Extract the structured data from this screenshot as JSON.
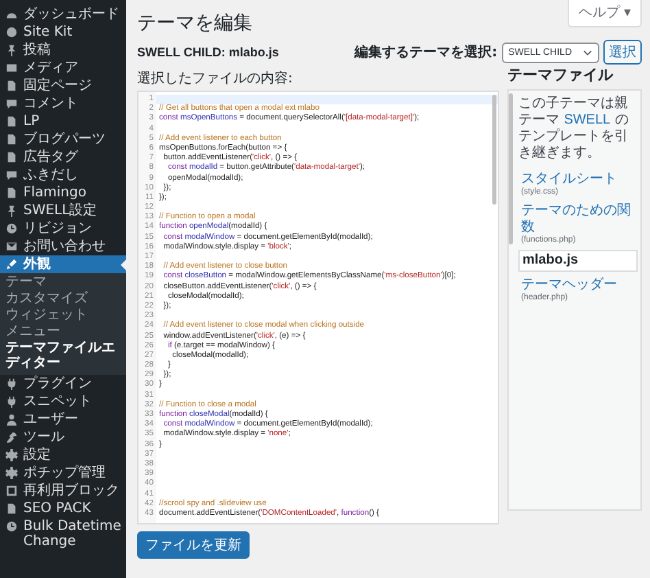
{
  "sidebar": {
    "items": [
      {
        "label": "ダッシュボード",
        "selected": false
      },
      {
        "label": "Site Kit",
        "selected": false
      },
      {
        "label": "投稿",
        "selected": false
      },
      {
        "label": "メディア",
        "selected": false
      },
      {
        "label": "固定ページ",
        "selected": false
      },
      {
        "label": "コメント",
        "selected": false
      },
      {
        "label": "LP",
        "selected": false
      },
      {
        "label": "ブログパーツ",
        "selected": false
      },
      {
        "label": "広告タグ",
        "selected": false
      },
      {
        "label": "ふきだし",
        "selected": false
      },
      {
        "label": "Flamingo",
        "selected": false
      },
      {
        "label": "SWELL設定",
        "selected": false
      },
      {
        "label": "リビジョン",
        "selected": false
      },
      {
        "label": "お問い合わせ",
        "selected": false
      },
      {
        "label": "外観",
        "selected": true,
        "children": [
          {
            "label": "テーマ",
            "selected": false
          },
          {
            "label": "カスタマイズ",
            "selected": false
          },
          {
            "label": "ウィジェット",
            "selected": false
          },
          {
            "label": "メニュー",
            "selected": false
          },
          {
            "label": "テーマファイルエディター",
            "selected": true
          }
        ]
      },
      {
        "label": "プラグイン",
        "selected": false
      },
      {
        "label": "スニペット",
        "selected": false
      },
      {
        "label": "ユーザー",
        "selected": false
      },
      {
        "label": "ツール",
        "selected": false
      },
      {
        "label": "設定",
        "selected": false
      },
      {
        "label": "ポチップ管理",
        "selected": false
      },
      {
        "label": "再利用ブロック",
        "selected": false
      },
      {
        "label": "SEO PACK",
        "selected": false
      },
      {
        "label": "Bulk Datetime Change",
        "selected": false
      }
    ]
  },
  "help_button": "ヘルプ ▾",
  "title": "テーマを編集",
  "file_title": "SWELL CHILD: mlabo.js",
  "theme_select": {
    "label": "編集するテーマを選択:",
    "value": "SWELL CHILD",
    "button": "選択"
  },
  "content_label": "選択したファイルの内容:",
  "editor": {
    "lines": [
      {
        "number": "1",
        "active": true
      },
      {
        "number": "2",
        "active": false,
        "text": "// Get all buttons that open a modal ext mlabo"
      },
      {
        "number": "3",
        "active": false,
        "text": "const msOpenButtons = document.querySelectorAll('[data-modal-target]');"
      },
      {
        "number": "4",
        "active": false
      },
      {
        "number": "5",
        "active": false,
        "text": "// Add event listener to each button"
      },
      {
        "number": "6",
        "active": false,
        "text": "msOpenButtons.forEach(button => {"
      },
      {
        "number": "7",
        "active": false,
        "text": "  button.addEventListener('click', () => {"
      },
      {
        "number": "8",
        "active": false,
        "text": "    const modalId = button.getAttribute('data-modal-target');"
      },
      {
        "number": "9",
        "active": false,
        "text": "    openModal(modalId);"
      },
      {
        "number": "10",
        "active": false,
        "text": "  });"
      },
      {
        "number": "11",
        "active": false,
        "text": "});"
      },
      {
        "number": "12",
        "active": false
      },
      {
        "number": "13",
        "active": false,
        "text": "// Function to open a modal"
      },
      {
        "number": "14",
        "active": false,
        "text": "function openModal(modalId) {"
      },
      {
        "number": "15",
        "active": false,
        "text": "  const modalWindow = document.getElementById(modalId);"
      },
      {
        "number": "16",
        "active": false,
        "text": "  modalWindow.style.display = 'block';"
      },
      {
        "number": "17",
        "active": false
      },
      {
        "number": "18",
        "active": false,
        "text": "  // Add event listener to close button"
      },
      {
        "number": "19",
        "active": false,
        "text": "  const closeButton = modalWindow.getElementsByClassName('ms-closeButton')[0];"
      },
      {
        "number": "20",
        "active": false,
        "text": "  closeButton.addEventListener('click', () => {"
      },
      {
        "number": "21",
        "active": false,
        "text": "    closeModal(modalId);"
      },
      {
        "number": "22",
        "active": false,
        "text": "  });"
      },
      {
        "number": "23",
        "active": false
      },
      {
        "number": "24",
        "active": false,
        "text": "  // Add event listener to close modal when clicking outside"
      },
      {
        "number": "25",
        "active": false,
        "text": "  window.addEventListener('click', (e) => {"
      },
      {
        "number": "26",
        "active": false,
        "text": "    if (e.target == modalWindow) {"
      },
      {
        "number": "27",
        "active": false,
        "text": "      closeModal(modalId);"
      },
      {
        "number": "28",
        "active": false,
        "text": "    }"
      },
      {
        "number": "29",
        "active": false,
        "text": "  });"
      },
      {
        "number": "30",
        "active": false,
        "text": "}"
      },
      {
        "number": "31",
        "active": false
      },
      {
        "number": "32",
        "active": false,
        "text": "// Function to close a modal"
      },
      {
        "number": "33",
        "active": false,
        "text": "function closeModal(modalId) {"
      },
      {
        "number": "34",
        "active": false,
        "text": "  const modalWindow = document.getElementById(modalId);"
      },
      {
        "number": "35",
        "active": false,
        "text": "  modalWindow.style.display = 'none';"
      },
      {
        "number": "36",
        "active": false,
        "text": "}"
      },
      {
        "number": "37",
        "active": false
      },
      {
        "number": "38",
        "active": false
      },
      {
        "number": "39",
        "active": false
      },
      {
        "number": "40",
        "active": false
      },
      {
        "number": "41",
        "active": false
      },
      {
        "number": "42",
        "active": false,
        "text": "//scrool spy and .slideview use"
      },
      {
        "number": "43",
        "active": false,
        "text": "document.addEventListener('DOMContentLoaded', function() {"
      }
    ]
  },
  "file_panel": {
    "title": "テーマファイル",
    "description": {
      "before": "この子テーマは親テーマ ",
      "link": "SWELL",
      "after": " のテンプレートを引き継ぎます。"
    },
    "files": [
      {
        "name": "スタイルシート",
        "file": "(style.css)",
        "selected": false
      },
      {
        "name": "テーマのための関数",
        "file": "(functions.php)",
        "selected": false
      },
      {
        "name": "mlabo.js",
        "selected": true
      },
      {
        "name": "テーマヘッダー",
        "file": "(header.php)",
        "selected": false
      }
    ]
  },
  "update_button": "ファイルを更新"
}
